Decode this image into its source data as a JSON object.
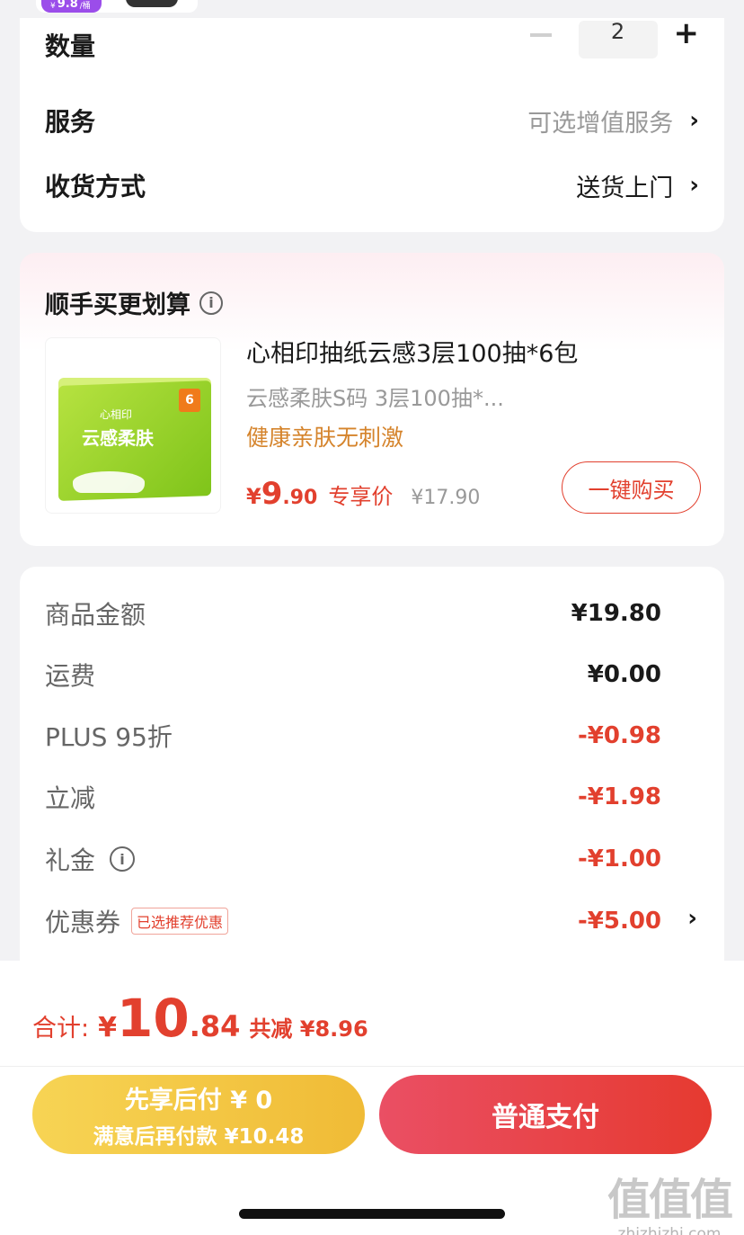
{
  "top_strip": {
    "price_prefix": "¥",
    "price": "9.8",
    "unit": "/桶"
  },
  "order": {
    "quantity_label": "数量",
    "quantity": "2",
    "service_label": "服务",
    "service_value": "可选增值服务",
    "delivery_label": "收货方式",
    "delivery_value": "送货上门"
  },
  "upsell": {
    "title": "顺手买更划算",
    "product_title": "心相印抽纸云感3层100抽*6包",
    "spec": "云感柔肤S码 3层100抽*...",
    "tag": "健康亲肤无刺激",
    "price_yen": "¥",
    "price_int": "9",
    "price_dec": ".90",
    "exclusive_label": "专享价",
    "original_price": "¥17.90",
    "buy_button": "一键购买",
    "pkg_brand": "心相印",
    "pkg_name": "云感柔肤",
    "pkg_count": "6"
  },
  "summary": {
    "rows": [
      {
        "label": "商品金额",
        "value": "¥19.80"
      },
      {
        "label": "运费",
        "value": "¥0.00"
      },
      {
        "label": "PLUS 95折",
        "value": "-¥0.98"
      },
      {
        "label": "立减",
        "value": "-¥1.98"
      },
      {
        "label": "礼金",
        "value": "-¥1.00"
      },
      {
        "label": "优惠券",
        "value": "-¥5.00"
      }
    ],
    "coupon_badge": "已选推荐优惠"
  },
  "footer": {
    "total_label": "合计:",
    "total_yen": "¥",
    "total_int": "10",
    "total_dec": ".84",
    "saved": "共减 ¥8.96",
    "pay_later_line1": "先享后付 ¥ 0",
    "pay_later_line2": "满意后再付款 ¥10.48",
    "pay_button": "普通支付"
  },
  "watermark": {
    "logo": "值值值",
    "url": "zhizhizhi.com"
  },
  "colors": {
    "accent_red": "#e2402e",
    "gold": "#f0bb36",
    "tag_orange": "#d5842c"
  }
}
